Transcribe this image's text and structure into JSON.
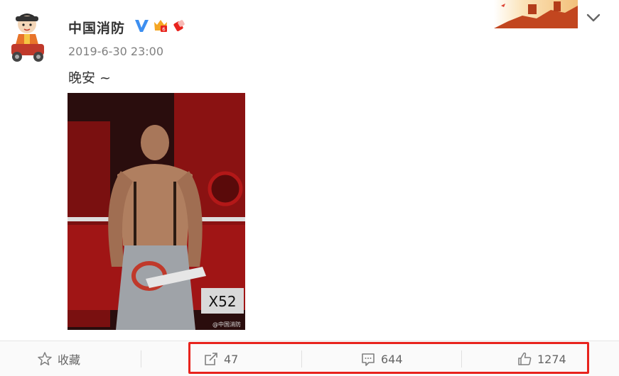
{
  "user": {
    "name": "中国消防",
    "verified_icon": "verified-v-icon",
    "badges": [
      "vip-crown-badge-icon",
      "flag-badge-icon"
    ]
  },
  "post": {
    "timestamp": "2019-6-30 23:00",
    "text": "晚安 ~",
    "image_watermark": "@中国消防"
  },
  "actions": {
    "favorite_label": "收藏",
    "repost_count": "47",
    "comment_count": "644",
    "like_count": "1274"
  },
  "colors": {
    "highlight_border": "#e8231d",
    "verified_blue": "#3d8ff0"
  }
}
